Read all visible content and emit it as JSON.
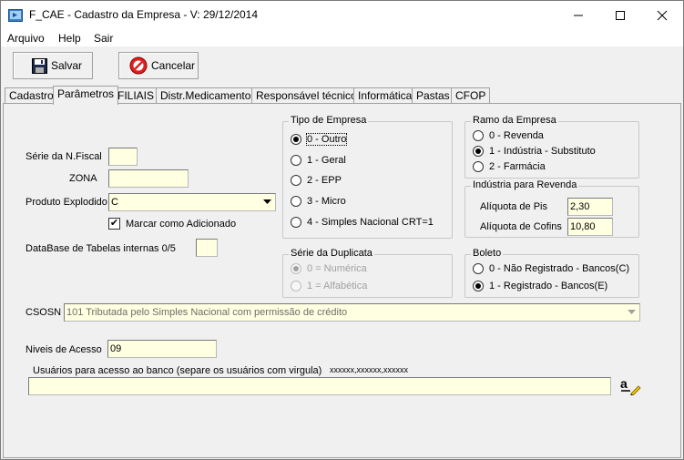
{
  "window": {
    "title": "F_CAE - Cadastro da Empresa - V: 29/12/2014",
    "minimize": "—",
    "maximize": "☐",
    "close": "✕"
  },
  "menu": [
    "Arquivo",
    "Help",
    "Sair"
  ],
  "toolbar": {
    "save_label": "Salvar",
    "cancel_label": "Cancelar"
  },
  "tabs": [
    {
      "label": "Cadastro"
    },
    {
      "label": "Parâmetros",
      "active": true
    },
    {
      "label": "FILIAIS"
    },
    {
      "label": "Distr.Medicamentos"
    },
    {
      "label": "Responsável técnico"
    },
    {
      "label": "Informática"
    },
    {
      "label": "Pastas"
    },
    {
      "label": "CFOP"
    }
  ],
  "form": {
    "serie_nf_label": "Série da N.Fiscal",
    "serie_nf_value": "",
    "zona_label": "ZONA",
    "zona_value": "",
    "produto_explodido_label": "Produto Explodido",
    "produto_explodido_value": "C",
    "marcar_adicionado_label": "Marcar como Adicionado",
    "marcar_adicionado_checked": true,
    "database_label": "DataBase de Tabelas internas 0/5",
    "database_value": "",
    "csosn_label": "CSOSN",
    "csosn_value": "101 Tributada pelo Simples Nacional com permissão de crédito",
    "niveis_label": "Niveis de Acesso",
    "niveis_value": "09",
    "usuarios_label": "Usuários para acesso ao banco (separe os usuários com virgula)",
    "usuarios_hint": "xxxxxx,xxxxxx,xxxxxx",
    "usuarios_value": ""
  },
  "tipo_empresa": {
    "title": "Tipo de Empresa",
    "options": [
      "0 - Outro",
      "1 - Geral",
      "2 - EPP",
      "3 - Micro",
      "4 - Simples Nacional CRT=1"
    ],
    "selected": 0
  },
  "serie_duplicata": {
    "title": "Série da Duplicata",
    "options": [
      "0 = Numérica",
      "1 = Alfabética"
    ],
    "selected": 0
  },
  "ramo_empresa": {
    "title": "Ramo da Empresa",
    "options": [
      "0 - Revenda",
      "1 - Indústria - Substituto",
      "2 - Farmácia"
    ],
    "selected": 1
  },
  "industria_revenda": {
    "title": "Indústria para Revenda",
    "pis_label": "Alíquota de Pis",
    "pis_value": "2,30",
    "cofins_label": "Alíquota de Cofins",
    "cofins_value": "10,80"
  },
  "boleto": {
    "title": "Boleto",
    "options": [
      "0 - Não Registrado - Bancos(C)",
      "1 - Registrado - Bancos(E)"
    ],
    "selected": 1
  },
  "icons": {
    "app": "app-icon",
    "save": "floppy-disk-icon",
    "cancel": "no-entry-icon",
    "spell": "spell-check-icon"
  }
}
